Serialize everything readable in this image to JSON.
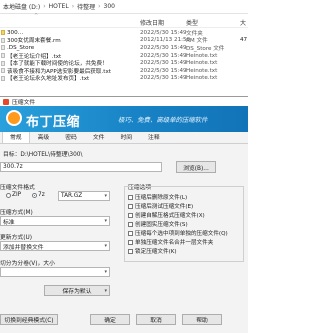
{
  "explorer": {
    "path": [
      "本地磁盘 (D:)",
      "HOTEL",
      "待整理",
      "300"
    ],
    "columns": {
      "date": "修改日期",
      "type": "类型",
      "size": "大"
    },
    "files": [
      {
        "name": "300…",
        "date": "2022/5/30 15:49",
        "type": "文件夹",
        "size": ""
      },
      {
        "name": "300女优周末套餐.rm",
        "date": "2012/11/13 21:50",
        "type": "RM 文件",
        "size": "47"
      },
      {
        "name": ".DS_Store",
        "date": "2022/5/30 15:49",
        "type": "DS_Store 文件",
        "size": ""
      },
      {
        "name": "【老王论坛介绍】.txt",
        "date": "2022/5/30 15:49",
        "type": "Heinote.txt",
        "size": ""
      },
      {
        "name": "【本了就能下载时间使的论坛，共免费！",
        "date": "2022/5/30 15:49",
        "type": "Heinote.txt",
        "size": ""
      },
      {
        "name": "该吸食不接和为APP选安影要最后获取.txt",
        "date": "2022/5/30 15:49",
        "type": "Heinote.txt",
        "size": ""
      },
      {
        "name": "【老王论坛永久地址发布页】.txt",
        "date": "2022/5/30 15:49",
        "type": "Heinote.txt",
        "size": ""
      }
    ]
  },
  "dialog": {
    "title": "压缩文件",
    "brand": "布丁压缩",
    "slogan": "极巧、免费、高级单的压缩软件",
    "tabs": [
      "常规",
      "高级",
      "密码",
      "文件",
      "时间",
      "注释"
    ],
    "target_label": "目标：D:\\HOTEL\\待整理\\300\\",
    "filename": "300.7z",
    "browse_label": "浏览(B)...",
    "format_label": "压缩文件格式",
    "formats": [
      "ZIP",
      "7z",
      "TAR.GZ"
    ],
    "selected_format": "7z",
    "method_label": "压缩方式(M)",
    "method_value": "标准",
    "split_label": "切分为分卷(V)，大小",
    "update_label": "更新方式(U)",
    "update_value": "添加并替换文件",
    "save_default": "保存为默认",
    "options_label": "压缩选项",
    "options": [
      "压缩后删除原文件(L)",
      "压缩后测试压缩文件(E)",
      "创建自解压格式压缩文件(X)",
      "创建固实压缩文件(S)",
      "压缩每个选中项到单独的压缩文件(Q)",
      "单独压缩文件名合并一层文件夹",
      "锁定压缩文件(K)"
    ],
    "classic_mode": "切换到经典模式(C)",
    "ok": "确定",
    "cancel": "取消",
    "help": "帮助"
  }
}
